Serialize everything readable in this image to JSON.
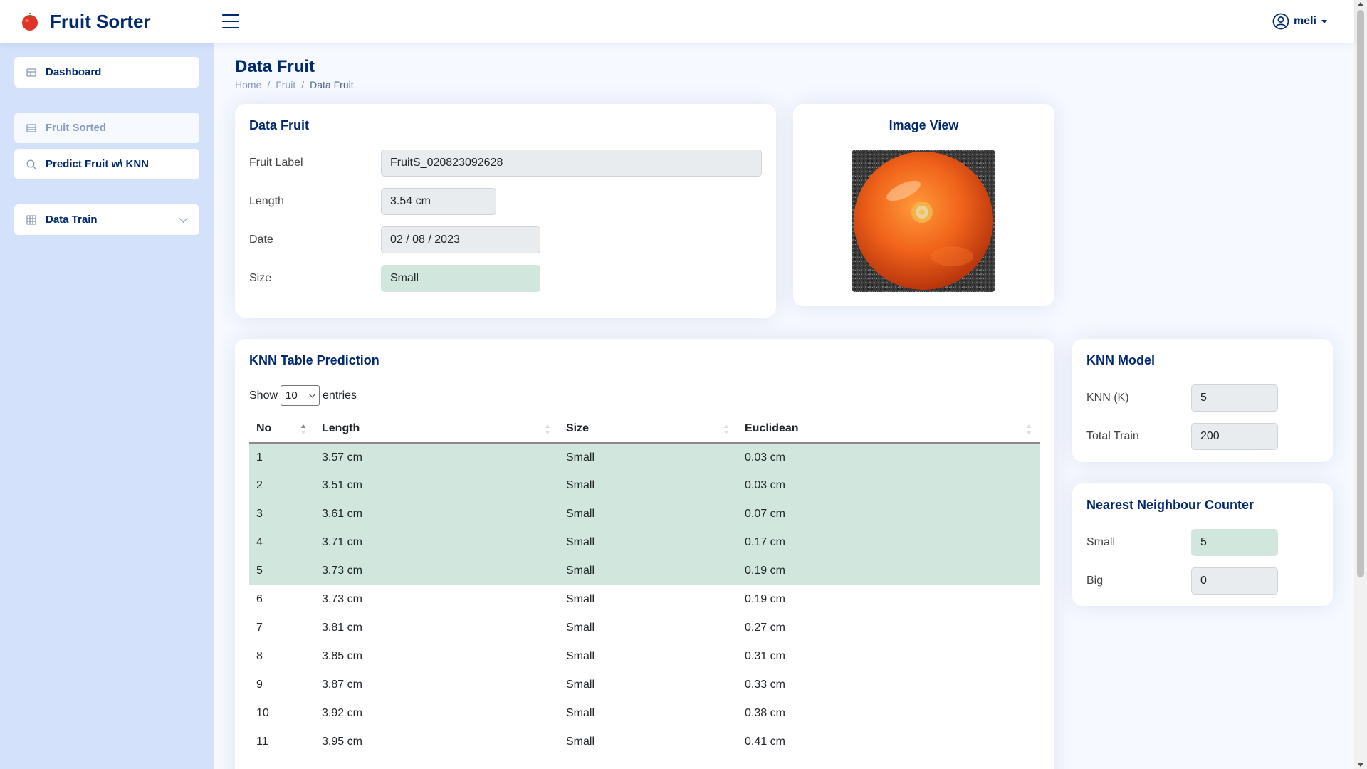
{
  "header": {
    "brand": "Fruit Sorter",
    "logo_icon": "tomato-icon",
    "user_name": "meli"
  },
  "sidebar": {
    "items": [
      {
        "label": "Dashboard",
        "icon": "grid-icon"
      },
      {
        "label": "Fruit Sorted",
        "icon": "list-icon"
      },
      {
        "label": "Predict Fruit w\\ KNN",
        "icon": "search-icon"
      },
      {
        "label": "Data Train",
        "icon": "table-icon"
      }
    ]
  },
  "page": {
    "title": "Data Fruit",
    "breadcrumb": [
      "Home",
      "Fruit",
      "Data Fruit"
    ]
  },
  "data_fruit": {
    "title": "Data Fruit",
    "fields": {
      "label_name": "Fruit Label",
      "label_value": "FruitS_020823092628",
      "length_name": "Length",
      "length_value": "3.54 cm",
      "date_name": "Date",
      "date_value": "02 / 08 / 2023",
      "size_name": "Size",
      "size_value": "Small"
    }
  },
  "image_view": {
    "title": "Image View"
  },
  "knn_table": {
    "title": "KNN Table Prediction",
    "show_label": "Show",
    "entries_value": "10",
    "entries_label": "entries",
    "columns": [
      "No",
      "Length",
      "Size",
      "Euclidean"
    ],
    "rows": [
      [
        "1",
        "3.57 cm",
        "Small",
        "0.03 cm"
      ],
      [
        "2",
        "3.51 cm",
        "Small",
        "0.03 cm"
      ],
      [
        "3",
        "3.61 cm",
        "Small",
        "0.07 cm"
      ],
      [
        "4",
        "3.71 cm",
        "Small",
        "0.17 cm"
      ],
      [
        "5",
        "3.73 cm",
        "Small",
        "0.19 cm"
      ],
      [
        "6",
        "3.73 cm",
        "Small",
        "0.19 cm"
      ],
      [
        "7",
        "3.81 cm",
        "Small",
        "0.27 cm"
      ],
      [
        "8",
        "3.85 cm",
        "Small",
        "0.31 cm"
      ],
      [
        "9",
        "3.87 cm",
        "Small",
        "0.33 cm"
      ],
      [
        "10",
        "3.92 cm",
        "Small",
        "0.38 cm"
      ],
      [
        "11",
        "3.95 cm",
        "Small",
        "0.41 cm"
      ]
    ],
    "highlight_count": 5,
    "highlight_color": "#d1e7dd"
  },
  "knn_model": {
    "title": "KNN Model",
    "k_label": "KNN (K)",
    "k_value": "5",
    "train_label": "Total Train",
    "train_value": "200"
  },
  "neighbour_counter": {
    "title": "Nearest Neighbour Counter",
    "small_label": "Small",
    "small_value": "5",
    "big_label": "Big",
    "big_value": "0"
  },
  "colors": {
    "brand": "#012970",
    "sidebar_bg": "#d3e1fb",
    "highlight": "#d1e7dd"
  }
}
